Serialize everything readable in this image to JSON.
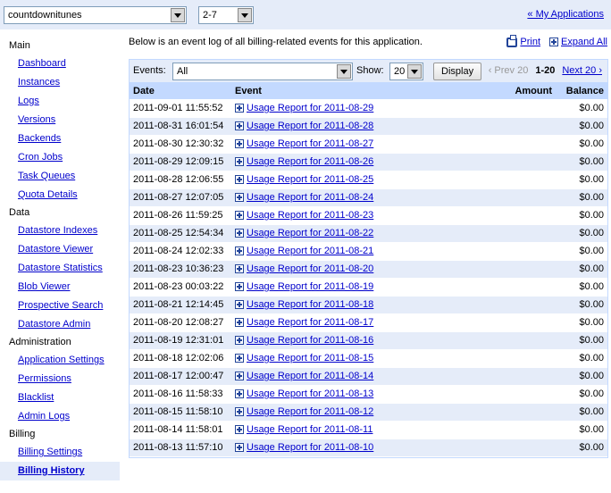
{
  "topbar": {
    "app_select": "countdownitunes",
    "version_select": "2-7",
    "my_apps_link": "« My Applications"
  },
  "sidebar": {
    "sections": [
      {
        "heading": "Main",
        "items": [
          "Dashboard",
          "Instances",
          "Logs",
          "Versions",
          "Backends",
          "Cron Jobs",
          "Task Queues",
          "Quota Details"
        ]
      },
      {
        "heading": "Data",
        "items": [
          "Datastore Indexes",
          "Datastore Viewer",
          "Datastore Statistics",
          "Blob Viewer",
          "Prospective Search",
          "Datastore Admin"
        ]
      },
      {
        "heading": "Administration",
        "items": [
          "Application Settings",
          "Permissions",
          "Blacklist",
          "Admin Logs"
        ]
      },
      {
        "heading": "Billing",
        "items": [
          "Billing Settings",
          "Billing History"
        ]
      }
    ],
    "active": "Billing History"
  },
  "main": {
    "intro": "Below is an event log of all billing-related events for this application.",
    "print_link": "Print",
    "expand_link": "Expand All",
    "controls": {
      "events_label": "Events:",
      "events_value": "All",
      "show_label": "Show:",
      "show_value": "20",
      "display_button": "Display",
      "prev": "‹ Prev 20",
      "range": "1-20",
      "next": "Next 20 ›"
    },
    "columns": {
      "date": "Date",
      "event": "Event",
      "amount": "Amount",
      "balance": "Balance"
    },
    "rows": [
      {
        "date": "2011-09-01 11:55:52",
        "event": "Usage Report for 2011-08-29",
        "amount": "",
        "balance": "$0.00"
      },
      {
        "date": "2011-08-31 16:01:54",
        "event": "Usage Report for 2011-08-28",
        "amount": "",
        "balance": "$0.00"
      },
      {
        "date": "2011-08-30 12:30:32",
        "event": "Usage Report for 2011-08-27",
        "amount": "",
        "balance": "$0.00"
      },
      {
        "date": "2011-08-29 12:09:15",
        "event": "Usage Report for 2011-08-26",
        "amount": "",
        "balance": "$0.00"
      },
      {
        "date": "2011-08-28 12:06:55",
        "event": "Usage Report for 2011-08-25",
        "amount": "",
        "balance": "$0.00"
      },
      {
        "date": "2011-08-27 12:07:05",
        "event": "Usage Report for 2011-08-24",
        "amount": "",
        "balance": "$0.00"
      },
      {
        "date": "2011-08-26 11:59:25",
        "event": "Usage Report for 2011-08-23",
        "amount": "",
        "balance": "$0.00"
      },
      {
        "date": "2011-08-25 12:54:34",
        "event": "Usage Report for 2011-08-22",
        "amount": "",
        "balance": "$0.00"
      },
      {
        "date": "2011-08-24 12:02:33",
        "event": "Usage Report for 2011-08-21",
        "amount": "",
        "balance": "$0.00"
      },
      {
        "date": "2011-08-23 10:36:23",
        "event": "Usage Report for 2011-08-20",
        "amount": "",
        "balance": "$0.00"
      },
      {
        "date": "2011-08-23 00:03:22",
        "event": "Usage Report for 2011-08-19",
        "amount": "",
        "balance": "$0.00"
      },
      {
        "date": "2011-08-21 12:14:45",
        "event": "Usage Report for 2011-08-18",
        "amount": "",
        "balance": "$0.00"
      },
      {
        "date": "2011-08-20 12:08:27",
        "event": "Usage Report for 2011-08-17",
        "amount": "",
        "balance": "$0.00"
      },
      {
        "date": "2011-08-19 12:31:01",
        "event": "Usage Report for 2011-08-16",
        "amount": "",
        "balance": "$0.00"
      },
      {
        "date": "2011-08-18 12:02:06",
        "event": "Usage Report for 2011-08-15",
        "amount": "",
        "balance": "$0.00"
      },
      {
        "date": "2011-08-17 12:00:47",
        "event": "Usage Report for 2011-08-14",
        "amount": "",
        "balance": "$0.00"
      },
      {
        "date": "2011-08-16 11:58:33",
        "event": "Usage Report for 2011-08-13",
        "amount": "",
        "balance": "$0.00"
      },
      {
        "date": "2011-08-15 11:58:10",
        "event": "Usage Report for 2011-08-12",
        "amount": "",
        "balance": "$0.00"
      },
      {
        "date": "2011-08-14 11:58:01",
        "event": "Usage Report for 2011-08-11",
        "amount": "",
        "balance": "$0.00"
      },
      {
        "date": "2011-08-13 11:57:10",
        "event": "Usage Report for 2011-08-10",
        "amount": "",
        "balance": "$0.00"
      }
    ]
  },
  "colors": {
    "header_band": "#e5ecf9",
    "table_header": "#c3d9ff",
    "link": "#0000cc"
  }
}
